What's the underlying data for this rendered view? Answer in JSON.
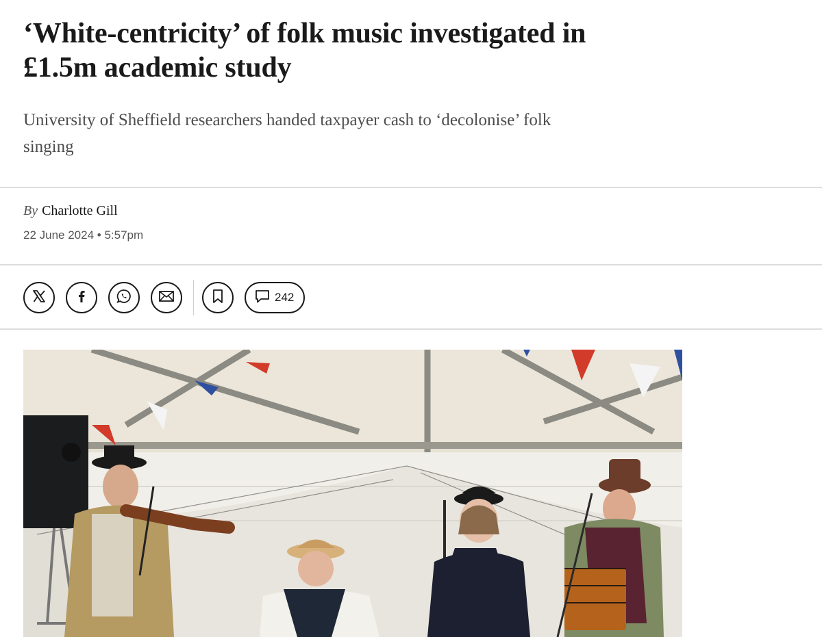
{
  "article": {
    "headline_line1": "‘White-centricity’ of folk music investigated in",
    "headline_line2": "£1.5m academic study",
    "standfirst_line1": "University of Sheffield researchers handed taxpayer cash to ‘decolonise’ folk",
    "standfirst_line2": "singing",
    "byline_prefix": "By",
    "author": "Charlotte Gill",
    "date": "22 June 2024",
    "time": "5:57pm",
    "date_separator": "•"
  },
  "share": {
    "icons": [
      "x-logo-icon",
      "facebook-icon",
      "whatsapp-icon",
      "email-icon",
      "bookmark-icon",
      "comment-icon"
    ],
    "comment_count": "242"
  },
  "photo": {
    "description_icon": "folk-band-photo",
    "colors": {
      "tent": "#e9e4d8",
      "frame": "#8a8a82",
      "bunting_red": "#d23a2a",
      "bunting_blue": "#2f4fa0",
      "bunting_white": "#f4f4f4"
    }
  }
}
